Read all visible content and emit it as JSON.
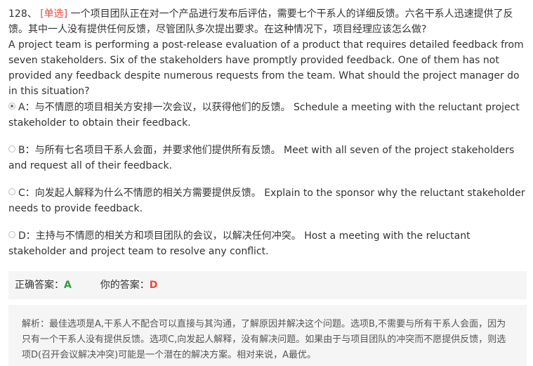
{
  "question": {
    "number": "128、",
    "type_label": "[单选]",
    "text_cn": "一个项目团队正在对一个产品进行发布后评估，需要七个干系人的详细反馈。六名干系人迅速提供了反馈。其中一人没有提供任何反馈，尽管团队多次提出要求。在这种情况下，项目经理应该怎么做?",
    "text_en": "A project team is performing a post-release evaluation of a product that requires detailed feedback from seven stakeholders. Six of the stakeholders have promptly provided feedback. One of them has not provided any feedback despite numerous requests from the team. What should the project manager do in this situation?"
  },
  "options": [
    {
      "key": "A",
      "text": "A：与不情愿的项目相关方安排一次会议，以获得他们的反馈。 Schedule a meeting with the reluctant project stakeholder to obtain their feedback.",
      "selected": true
    },
    {
      "key": "B",
      "text": "B：与所有七名项目干系人会面，并要求他们提供所有反馈。 Meet with all seven of the project stakeholders and request all of their feedback.",
      "selected": false
    },
    {
      "key": "C",
      "text": "C：向发起人解释为什么不情愿的相关方需要提供反馈。 Explain to the sponsor why the reluctant stakeholder needs to provide feedback.",
      "selected": false
    },
    {
      "key": "D",
      "text": "D：主持与不情愿的相关方和项目团队的会议，以解决任何冲突。 Host a meeting with the reluctant stakeholder and project team to resolve any conflict.",
      "selected": false
    }
  ],
  "answer": {
    "correct_label": "正确答案：",
    "correct_value": "A",
    "yours_label": "你的答案：",
    "yours_value": "D"
  },
  "analysis": {
    "text": "解析：最佳选项是A,干系人不配合可以直接与其沟通，了解原因并解决这个问题。选项B,不需要与所有干系人会面，因为只有一个干系人没有提供反馈。选项C,向发起人解释，没有解决问题。如果由于与项目团队的冲突而不愿提供反馈，则选项D(召开会议解决冲突)可能是一个潜在的解决方案。相对来说，A最优。"
  },
  "colors": {
    "type_label": "#e74c3c",
    "correct": "#2e9c3c",
    "wrong": "#e74c3c",
    "panel_bg": "#f5f5f5"
  }
}
